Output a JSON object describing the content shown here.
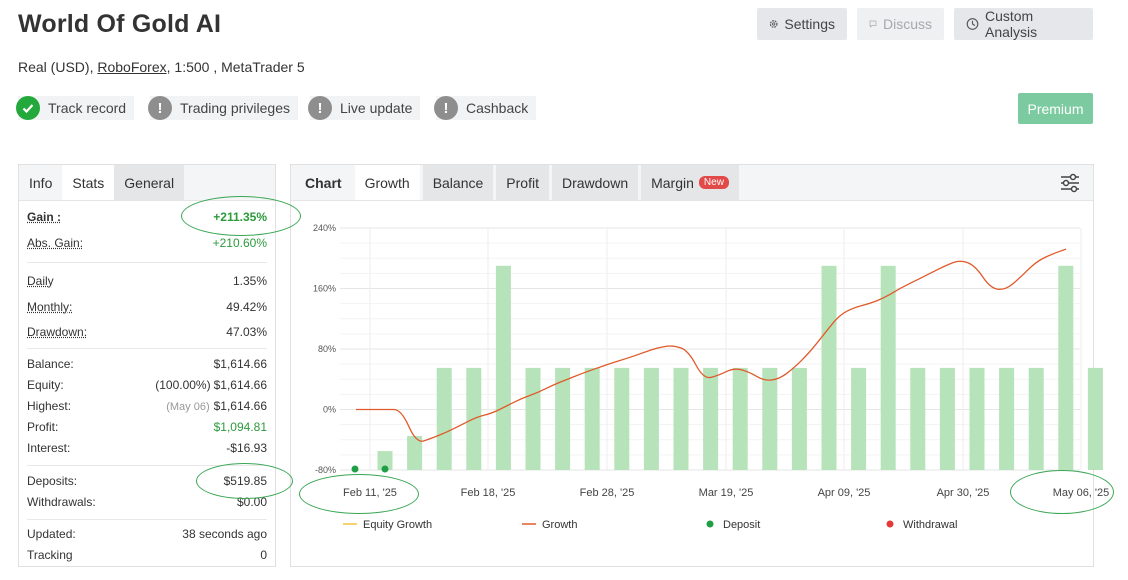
{
  "header": {
    "title": "World Of Gold AI",
    "account_type": "Real (USD), ",
    "broker": "RoboForex",
    "account_rest": ", 1:500 , MetaTrader 5"
  },
  "toolbar": {
    "settings": "Settings",
    "discuss": "Discuss",
    "custom_analysis": "Custom Analysis",
    "premium": "Premium"
  },
  "badges": [
    {
      "label": "Track record",
      "status": "verified"
    },
    {
      "label": "Trading privileges",
      "status": "warning"
    },
    {
      "label": "Live update",
      "status": "warning"
    },
    {
      "label": "Cashback",
      "status": "warning"
    }
  ],
  "stats_tabs": [
    "Info",
    "Stats",
    "General"
  ],
  "stats": {
    "gain": {
      "label": "Gain :",
      "value": "+211.35%"
    },
    "abs_gain": {
      "label": "Abs. Gain:",
      "value": "+210.60%"
    },
    "daily": {
      "label": "Daily",
      "value": "1.35%"
    },
    "monthly": {
      "label": "Monthly:",
      "value": "49.42%"
    },
    "drawdown": {
      "label": "Drawdown:",
      "value": "47.03%"
    },
    "balance": {
      "label": "Balance:",
      "value": "$1,614.66"
    },
    "equity": {
      "label": "Equity:",
      "pre": "(100.00%)",
      "value": "$1,614.66"
    },
    "highest": {
      "label": "Highest:",
      "pre": "(May 06)",
      "value": "$1,614.66"
    },
    "profit": {
      "label": "Profit:",
      "value": "$1,094.81"
    },
    "interest": {
      "label": "Interest:",
      "value": "-$16.93"
    },
    "deposits": {
      "label": "Deposits:",
      "value": "$519.85"
    },
    "withdrawals": {
      "label": "Withdrawals:",
      "value": "$0.00"
    },
    "updated": {
      "label": "Updated:",
      "value": "38 seconds ago"
    },
    "tracking": {
      "label": "Tracking",
      "value": "0"
    }
  },
  "chart_tabs": [
    {
      "label": "Chart"
    },
    {
      "label": "Growth"
    },
    {
      "label": "Balance"
    },
    {
      "label": "Profit"
    },
    {
      "label": "Drawdown"
    },
    {
      "label": "Margin",
      "pill": "New"
    }
  ],
  "chart_data": {
    "type": "bar",
    "y_ticks": [
      "240%",
      "160%",
      "80%",
      "0%",
      "-80%"
    ],
    "ylim": [
      -80,
      240
    ],
    "x_tick_labels": [
      "Feb 11, '25",
      "Feb 18, '25",
      "Feb 28, '25",
      "Mar 19, '25",
      "Apr 09, '25",
      "Apr 30, '25",
      "May 06, '25"
    ],
    "bars": [
      -55,
      -35,
      55,
      55,
      190,
      55,
      55,
      55,
      55,
      55,
      55,
      55,
      55,
      55,
      55,
      190,
      55,
      190,
      55,
      55,
      55,
      55,
      55,
      190,
      55
    ],
    "growth": [
      0,
      0,
      0,
      0,
      -45,
      -38,
      -30,
      -20,
      -10,
      -5,
      5,
      15,
      22,
      32,
      40,
      48,
      55,
      62,
      68,
      75,
      82,
      85,
      78,
      40,
      45,
      55,
      50,
      38,
      40,
      55,
      75,
      100,
      125,
      135,
      140,
      148,
      160,
      170,
      180,
      190,
      198,
      190,
      160,
      158,
      175,
      195,
      205,
      212
    ],
    "legend": [
      {
        "label": "Equity Growth",
        "color": "#f6c343",
        "marker": "line"
      },
      {
        "label": "Growth",
        "color": "#e05a2b",
        "marker": "line"
      },
      {
        "label": "Deposit",
        "color": "#1e9e45",
        "marker": "dot"
      },
      {
        "label": "Withdrawal",
        "color": "#e23a3a",
        "marker": "dot"
      }
    ]
  },
  "colors": {
    "accent_green": "#23a93b",
    "bar_green": "#b6e3b9",
    "growth_line": "#e05a2b",
    "premium": "#7ccba0"
  }
}
